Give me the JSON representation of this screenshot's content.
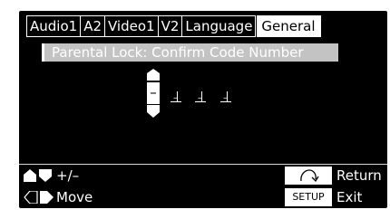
{
  "tabs": [
    {
      "label": "Audio1"
    },
    {
      "label": "A2"
    },
    {
      "label": "Video1"
    },
    {
      "label": "V2"
    },
    {
      "label": "Language"
    },
    {
      "label": "General",
      "active": true
    }
  ],
  "title": "Parental Lock: Confirm Code Number",
  "code": {
    "current_digit": "–",
    "slots": [
      "–",
      "–",
      "–"
    ]
  },
  "footer": {
    "adjust_label": "+/–",
    "move_label": "Move",
    "return_label": "Return",
    "setup_key_label": "SETUP",
    "exit_label": "Exit"
  },
  "colors": {
    "background": "#000000",
    "title_bar": "#c3c3c3",
    "foreground": "#ffffff"
  }
}
